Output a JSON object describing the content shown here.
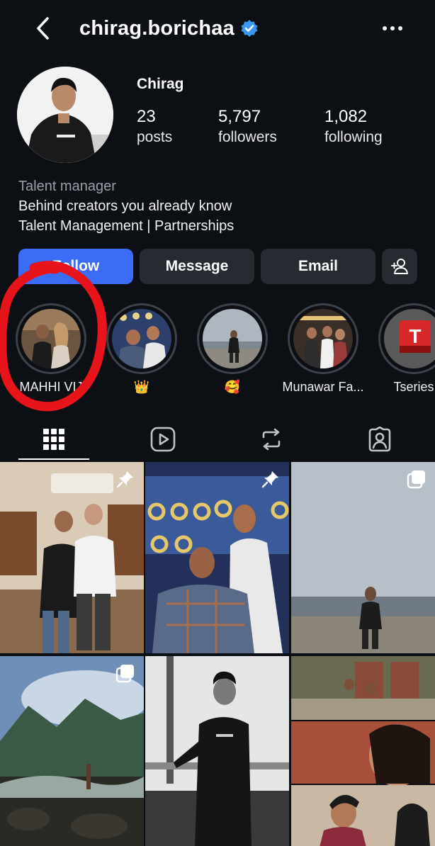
{
  "header": {
    "username": "chirag.borichaa",
    "back_icon": "chevron-left-icon",
    "verified_icon": "verified-badge-icon",
    "more_icon": "more-horizontal-icon"
  },
  "profile": {
    "display_name": "Chirag",
    "stats": [
      {
        "value": "23",
        "label": "posts"
      },
      {
        "value": "5,797",
        "label": "followers"
      },
      {
        "value": "1,082",
        "label": "following"
      }
    ],
    "category": "Talent manager",
    "bio_lines": [
      "Behind creators you already know",
      "Talent Management | Partnerships"
    ]
  },
  "actions": {
    "follow": "Follow",
    "message": "Message",
    "email": "Email",
    "add_user_icon": "add-user-icon"
  },
  "highlights": [
    {
      "label": "MAHHI VIJ"
    },
    {
      "label": "👑"
    },
    {
      "label": "🥰"
    },
    {
      "label": "Munawar Fa..."
    },
    {
      "label": "Tseries"
    }
  ],
  "tabs": [
    {
      "icon": "grid-icon",
      "selected": true
    },
    {
      "icon": "reels-icon",
      "selected": false
    },
    {
      "icon": "reposts-icon",
      "selected": false
    },
    {
      "icon": "tagged-icon",
      "selected": false
    }
  ],
  "colors": {
    "background": "#0c0f14",
    "follow_button": "#3b6cf6",
    "secondary_button": "#262a31",
    "verified": "#3897f0",
    "annotation": "#e8141b"
  }
}
